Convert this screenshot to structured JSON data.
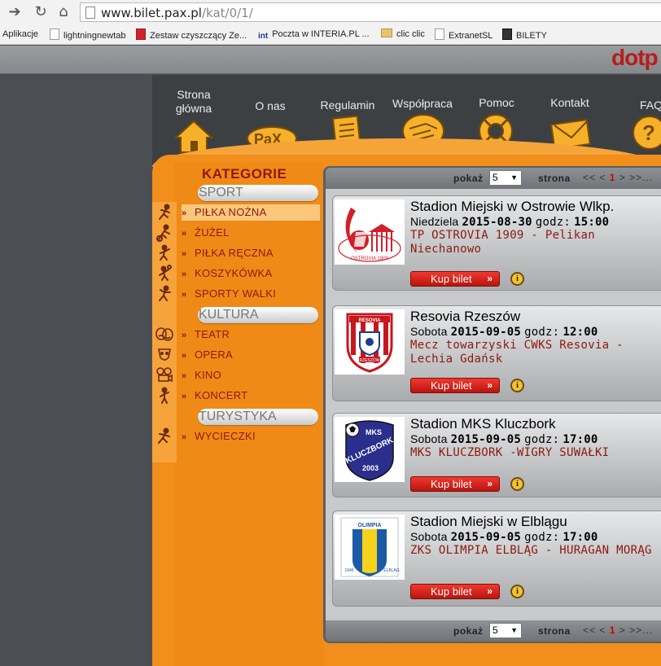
{
  "browser": {
    "url_host": "www.bilet.pax.pl",
    "url_path": "/kat/0/1/",
    "bookmarks": [
      "Aplikacje",
      "lightningnewtab",
      "Zestaw czyszczący Ze...",
      "Poczta w INTERIA.PL ...",
      "clic clic",
      "ExtranetSL",
      "BILETY"
    ],
    "bookmark_int_label": "int"
  },
  "site": {
    "brand_partial": "dotp",
    "nav": [
      {
        "label": "Strona\ngłówna",
        "icon": "house-icon"
      },
      {
        "label": "O nas",
        "icon": "pax-logo-icon"
      },
      {
        "label": "Regulamin",
        "icon": "document-icon"
      },
      {
        "label": "Współpraca",
        "icon": "handshake-icon"
      },
      {
        "label": "Pomoc",
        "icon": "lifebuoy-icon"
      },
      {
        "label": "Kontakt",
        "icon": "envelope-icon"
      },
      {
        "label": "FAQ",
        "icon": "question-icon"
      }
    ],
    "categories_title": "KATEGORIE",
    "groups": {
      "sport": "SPORT",
      "kultura": "KULTURA",
      "turystyka": "TURYSTYKA"
    },
    "items": {
      "pilka_nozna": "PIŁKA NOŻNA",
      "zuzel": "ŻUŻEL",
      "pilka_reczna": "PIŁKA RĘCZNA",
      "koszykowka": "KOSZYKÓWKA",
      "sporty_walki": "SPORTY WALKI",
      "teatr": "TEATR",
      "opera": "OPERA",
      "kino": "KINO",
      "koncert": "KONCERT",
      "wycieczki": "WYCIECZKI"
    },
    "item_bullet": "»"
  },
  "pager": {
    "show_label": "pokaż",
    "show_value": "5",
    "page_label": "strona",
    "nav_prev": "<< <",
    "current": "1",
    "nav_next": "> >>..."
  },
  "events": [
    {
      "venue": "Stadion Miejski w Ostrowie Wlkp.",
      "day": "Niedziela",
      "date": "2015-08-30",
      "time_label": "godz:",
      "time": "15:00",
      "title": "TP OSTROVIA 1909 - Pelikan Niechanowo",
      "logo": "ostrovia-crest"
    },
    {
      "venue": "Resovia Rzeszów",
      "day": "Sobota",
      "date": "2015-09-05",
      "time_label": "godz:",
      "time": "12:00",
      "title": "Mecz towarzyski CWKS Resovia - Lechia Gdańsk",
      "logo": "resovia-crest"
    },
    {
      "venue": "Stadion MKS Kluczbork",
      "day": "Sobota",
      "date": "2015-09-05",
      "time_label": "godz:",
      "time": "17:00",
      "title": "MKS KLUCZBORK -WIGRY SUWAŁKI",
      "logo": "kluczbork-crest"
    },
    {
      "venue": "Stadion Miejski w Elblągu",
      "day": "Sobota",
      "date": "2015-09-05",
      "time_label": "godz:",
      "time": "17:00",
      "title": "ZKS OLIMPIA ELBLĄG - HURAGAN MORĄG",
      "logo": "olimpia-crest"
    }
  ],
  "buy_label": "Kup bilet",
  "buy_chevron": "»",
  "info_glyph": "i",
  "logo_text": {
    "ostrovia": "OSTROVIA 1909",
    "resovia_top": "RESOVIA",
    "resovia_bottom": "RZESZÓW",
    "kluczbork_top": "MKS",
    "kluczbork_mid": "KLUCZBORK",
    "kluczbork_year": "2003",
    "olimpia_top": "OLIMPIA",
    "olimpia_left": "1946",
    "olimpia_right": "ELBLĄG"
  },
  "colors": {
    "orange": "#f28e1c",
    "dark_red": "#8b1a0f",
    "buy_red": "#d9231b",
    "brand_red": "#b71d1d"
  }
}
